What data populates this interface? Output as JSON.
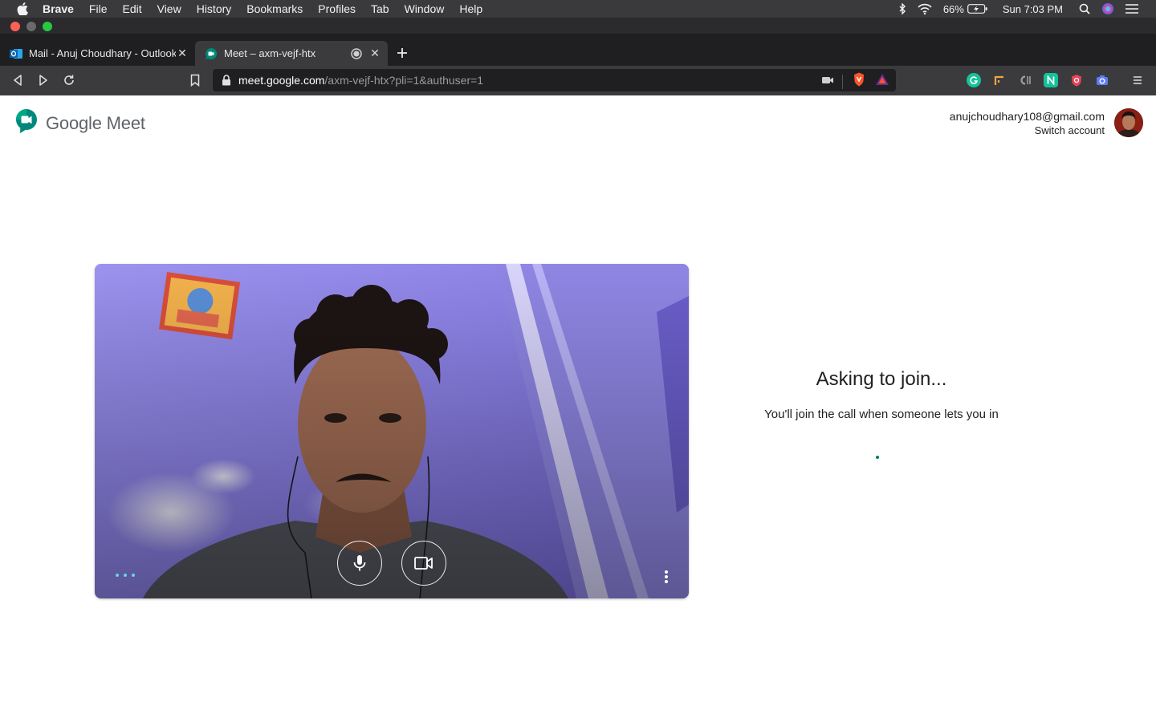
{
  "menubar": {
    "app_name": "Brave",
    "items": [
      "File",
      "Edit",
      "View",
      "History",
      "Bookmarks",
      "Profiles",
      "Tab",
      "Window",
      "Help"
    ],
    "battery": "66%",
    "clock": "Sun 7:03 PM"
  },
  "tabs": [
    {
      "title": "Mail - Anuj Choudhary - Outlook",
      "icon": "outlook-icon"
    },
    {
      "title": "Meet – axm-vejf-htx",
      "icon": "google-meet-icon"
    }
  ],
  "toolbar": {
    "url_host": "meet.google.com",
    "url_path": "/axm-vejf-htx?pli=1&authuser=1"
  },
  "header": {
    "logo_text": "Google Meet",
    "email": "anujchoudhary108@gmail.com",
    "switch_account": "Switch account"
  },
  "join": {
    "title": "Asking to join...",
    "subtitle": "You'll join the call when someone lets you in"
  },
  "colors": {
    "accent": "#00796b",
    "menubar_bg": "#3a3a3c",
    "tabstrip_bg": "#1f1f21",
    "toolbar_bg": "#3b3b3d"
  }
}
